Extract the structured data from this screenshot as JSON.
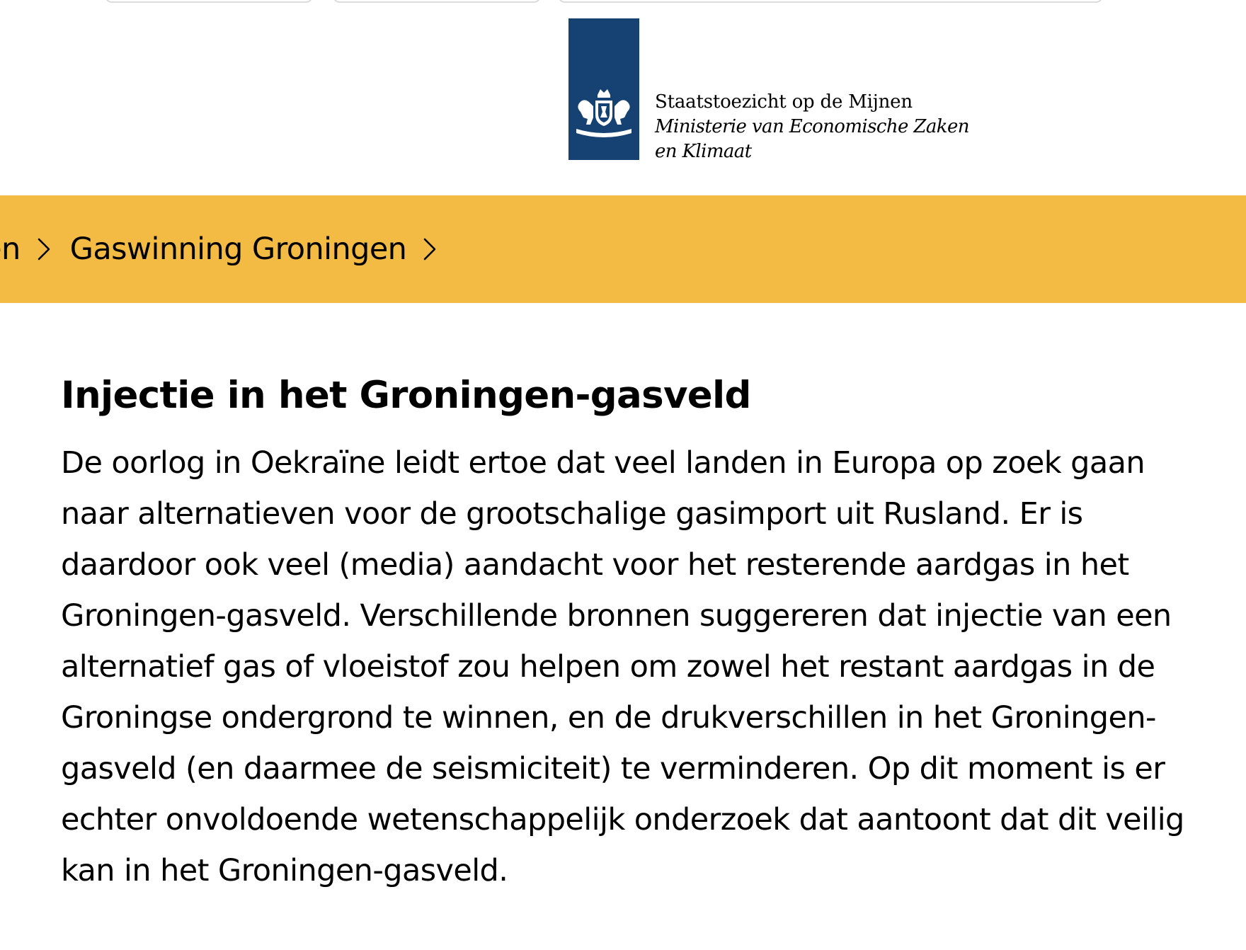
{
  "brand": {
    "organization": "Staatstoezicht op de Mijnen",
    "ministry_line1": "Ministerie van Economische Zaken",
    "ministry_line2": "en Klimaat",
    "logo_color": "#154273",
    "emblem_icon": "coat-of-arms-icon"
  },
  "breadcrumb": {
    "items": [
      {
        "label": "ren"
      },
      {
        "label": "Gaswinning Groningen"
      }
    ],
    "separator_icon": "chevron-right-icon",
    "background_color": "#f3bb43"
  },
  "article": {
    "title": "Injectie in het Groningen-gasveld",
    "body": "De oorlog in Oekraïne leidt ertoe dat veel landen in Europa op zoek gaan naar alternatieven voor de grootschalige gasimport uit Rusland. Er is daardoor ook veel (media) aandacht voor het resterende aardgas in het Groningen-gasveld. Verschillende bronnen suggereren dat injectie van een alternatief gas of vloeistof zou helpen om zowel het restant aardgas in de Groningse ondergrond te winnen, en de drukverschillen in het Groningen-gasveld (en daarmee de seismiciteit) te verminderen. Op dit moment is er echter onvoldoende wetenschappelijk onderzoek dat aantoont dat dit veilig kan in het Groningen-gasveld."
  }
}
